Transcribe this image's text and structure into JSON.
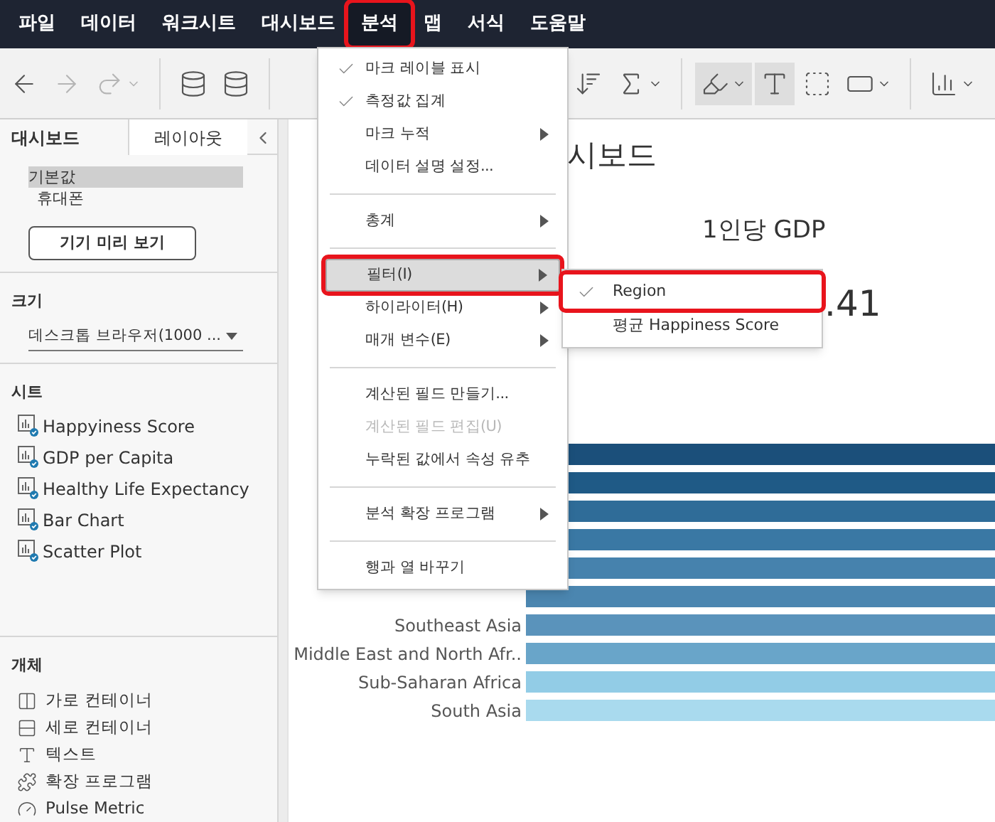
{
  "menu_bar": [
    {
      "label": "파일",
      "selected": false
    },
    {
      "label": "데이터",
      "selected": false
    },
    {
      "label": "워크시트",
      "selected": false
    },
    {
      "label": "대시보드",
      "selected": false
    },
    {
      "label": "분석",
      "selected": true
    },
    {
      "label": "맵",
      "selected": false
    },
    {
      "label": "서식",
      "selected": false
    },
    {
      "label": "도움말",
      "selected": false
    }
  ],
  "toolbar": [
    {
      "kind": "back",
      "disabled": false
    },
    {
      "kind": "forward",
      "disabled": true
    },
    {
      "kind": "redo",
      "disabled": true
    },
    {
      "kind": "sep"
    },
    {
      "kind": "new-source",
      "disabled": false
    },
    {
      "kind": "pause-source",
      "disabled": false
    },
    {
      "kind": "sep"
    }
  ],
  "toolbar_right": [
    {
      "kind": "sort",
      "selected": false
    },
    {
      "kind": "sigma",
      "selected": false
    },
    {
      "kind": "sep"
    },
    {
      "kind": "highlighter",
      "selected": true
    },
    {
      "kind": "text",
      "selected": true
    },
    {
      "kind": "annotate",
      "selected": false
    },
    {
      "kind": "fit",
      "selected": false
    },
    {
      "kind": "sep"
    },
    {
      "kind": "show-me",
      "selected": false
    }
  ],
  "side_panel": {
    "tabs": [
      {
        "label": "대시보드",
        "selected": true
      },
      {
        "label": "레이아웃",
        "selected": false
      }
    ],
    "devices": [
      {
        "label": "기본값",
        "selected": true
      },
      {
        "label": "휴대폰",
        "selected": false
      }
    ],
    "preview_button": "기기 미리 보기",
    "size_heading": "크기",
    "size_value": "데스크톱 브라우저(1000 ...",
    "sheets_heading": "시트",
    "sheets": [
      "Happyiness Score",
      "GDP per Capita",
      "Healthy Life Expectancy",
      "Bar Chart",
      "Scatter Plot"
    ],
    "objects_heading": "개체",
    "objects": [
      {
        "kind": "horizontal",
        "label": "가로 컨테이너"
      },
      {
        "kind": "vertical",
        "label": "세로 컨테이너"
      },
      {
        "kind": "text",
        "label": "텍스트"
      },
      {
        "kind": "extension",
        "label": "확장 프로그램"
      },
      {
        "kind": "pulse",
        "label": "Pulse Metric"
      }
    ]
  },
  "dashboard": {
    "title": "시보드",
    "kpi_title": "1인당 GDP",
    "kpi_value": ".41",
    "bar_labels": [
      "Southeast Asia",
      "Middle East and North Afr..",
      "Sub-Saharan Africa",
      "South Asia"
    ]
  },
  "analysis_menu": [
    {
      "kind": "item",
      "label": "마크 레이블 표시",
      "checked": true,
      "submenu": false,
      "disabled": false,
      "selected": false
    },
    {
      "kind": "item",
      "label": "측정값 집계",
      "checked": true,
      "submenu": false,
      "disabled": false,
      "selected": false
    },
    {
      "kind": "item",
      "label": "마크 누적",
      "checked": false,
      "submenu": true,
      "disabled": false,
      "selected": false
    },
    {
      "kind": "item",
      "label": "데이터 설명 설정...",
      "checked": false,
      "submenu": false,
      "disabled": false,
      "selected": false
    },
    {
      "kind": "separator"
    },
    {
      "kind": "item",
      "label": "총계",
      "checked": false,
      "submenu": true,
      "disabled": false,
      "selected": false
    },
    {
      "kind": "separator"
    },
    {
      "kind": "item",
      "label": "필터(I)",
      "checked": false,
      "submenu": true,
      "disabled": false,
      "selected": true
    },
    {
      "kind": "item",
      "label": "하이라이터(H)",
      "checked": false,
      "submenu": true,
      "disabled": false,
      "selected": false
    },
    {
      "kind": "item",
      "label": "매개 변수(E)",
      "checked": false,
      "submenu": true,
      "disabled": false,
      "selected": false
    },
    {
      "kind": "separator"
    },
    {
      "kind": "item",
      "label": "계산된 필드 만들기...",
      "checked": false,
      "submenu": false,
      "disabled": false,
      "selected": false
    },
    {
      "kind": "item",
      "label": "계산된 필드 편집(U)",
      "checked": false,
      "submenu": false,
      "disabled": true,
      "selected": false
    },
    {
      "kind": "item",
      "label": "누락된 값에서 속성 유추",
      "checked": false,
      "submenu": false,
      "disabled": false,
      "selected": false
    },
    {
      "kind": "separator"
    },
    {
      "kind": "item",
      "label": "분석 확장 프로그램",
      "checked": false,
      "submenu": true,
      "disabled": false,
      "selected": false
    },
    {
      "kind": "separator"
    },
    {
      "kind": "item",
      "label": "행과 열 바꾸기",
      "checked": false,
      "submenu": false,
      "disabled": false,
      "selected": false
    }
  ],
  "filter_submenu": [
    {
      "label": "Region",
      "checked": true,
      "selected": true
    },
    {
      "label": "평균 Happiness Score",
      "checked": false,
      "selected": false
    }
  ]
}
